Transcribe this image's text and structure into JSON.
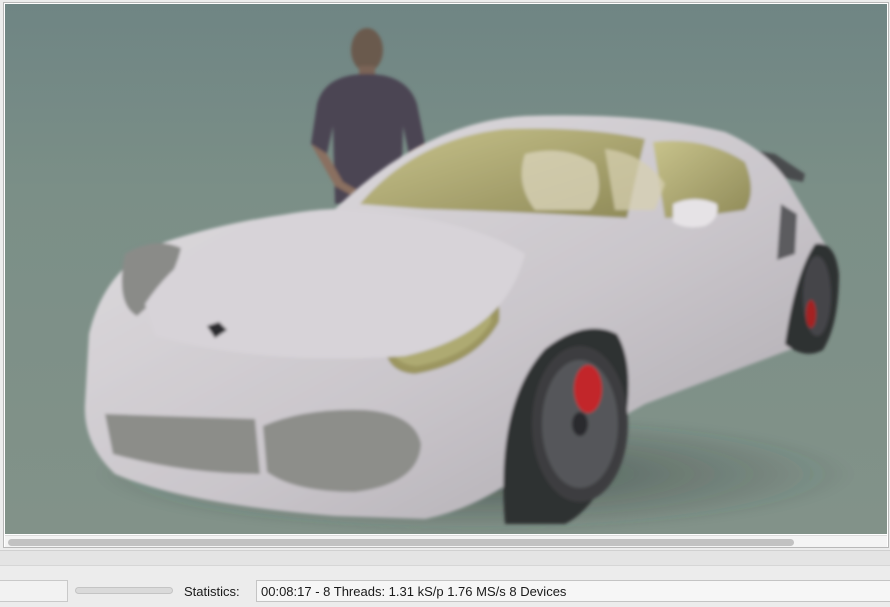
{
  "render_view": {
    "image": "rendered-sports-car-scene",
    "background_color": "#7f8e86",
    "car_color": "#c7c4c7",
    "brake_caliper_color": "#c2262a"
  },
  "statusbar": {
    "progress": 0.0,
    "statistics_label": "Statistics:",
    "statistics_value": "00:08:17 - 8 Threads: 1.31 kS/p  1.76 MS/s  8 Devices"
  }
}
